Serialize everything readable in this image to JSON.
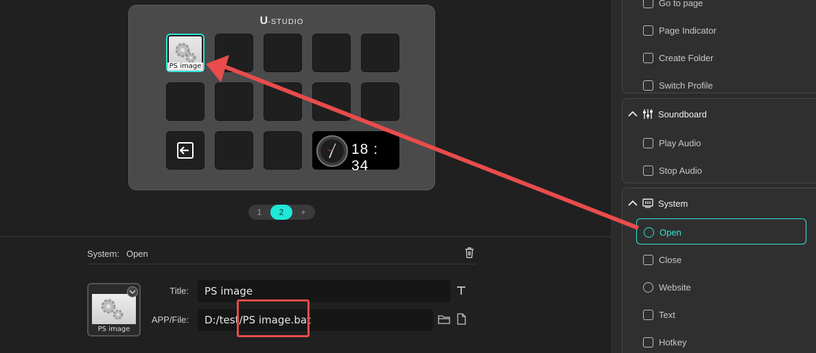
{
  "device": {
    "brand_main": "U",
    "brand_rest": "-STUDIO",
    "selected_key_label": "PS image",
    "clock_time": "18 : 34"
  },
  "pager": {
    "pages": [
      "1",
      "2"
    ],
    "active": "2",
    "add": "+"
  },
  "properties": {
    "category": "System:",
    "action": "Open",
    "icon_label": "PS image",
    "title_label": "Title:",
    "title_value": "PS image",
    "app_label": "APP/File:",
    "app_value": "D:/test/PS image.bat"
  },
  "sidebar": {
    "top_items": [
      "Go to page",
      "Page Indicator",
      "Create Folder",
      "Switch Profile"
    ],
    "soundboard": {
      "title": "Soundboard",
      "items": [
        "Play Audio",
        "Stop Audio"
      ]
    },
    "system": {
      "title": "System",
      "items": [
        "Open",
        "Close",
        "Website",
        "Text",
        "Hotkey"
      ],
      "active": "Open"
    }
  },
  "colors": {
    "accent": "#2ee6d6",
    "annotation": "#e84c4c"
  }
}
